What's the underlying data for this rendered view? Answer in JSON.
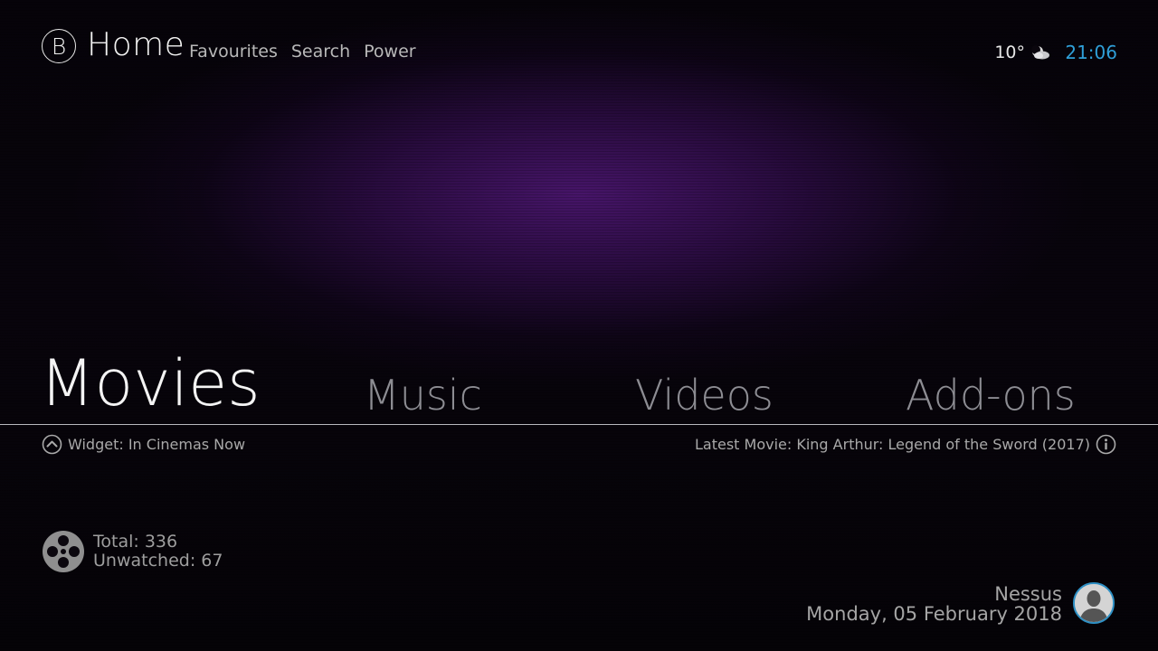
{
  "header": {
    "logo_letter": "B",
    "title": "Home",
    "nav": [
      "Favourites",
      "Search",
      "Power"
    ],
    "weather": {
      "temperature": "10°",
      "icon": "partly-cloudy-night-icon"
    },
    "clock": "21:06",
    "clock_color": "#2f9fd8"
  },
  "menu": {
    "items": [
      {
        "label": "Movies",
        "active": true
      },
      {
        "label": "Music",
        "active": false
      },
      {
        "label": "Videos",
        "active": false
      },
      {
        "label": "Add-ons",
        "active": false
      }
    ]
  },
  "info_row": {
    "widget_label": "Widget: In Cinemas Now",
    "latest_label": "Latest Movie: King Arthur: Legend of the Sword (2017)"
  },
  "stats": {
    "total": "Total: 336",
    "unwatched": "Unwatched: 67"
  },
  "user": {
    "name": "Nessus",
    "date": "Monday, 05 February 2018",
    "avatar_ring_color": "#2d8fc4"
  },
  "colors": {
    "background_glow": "#4a166e",
    "accent": "#2f9fd8"
  }
}
